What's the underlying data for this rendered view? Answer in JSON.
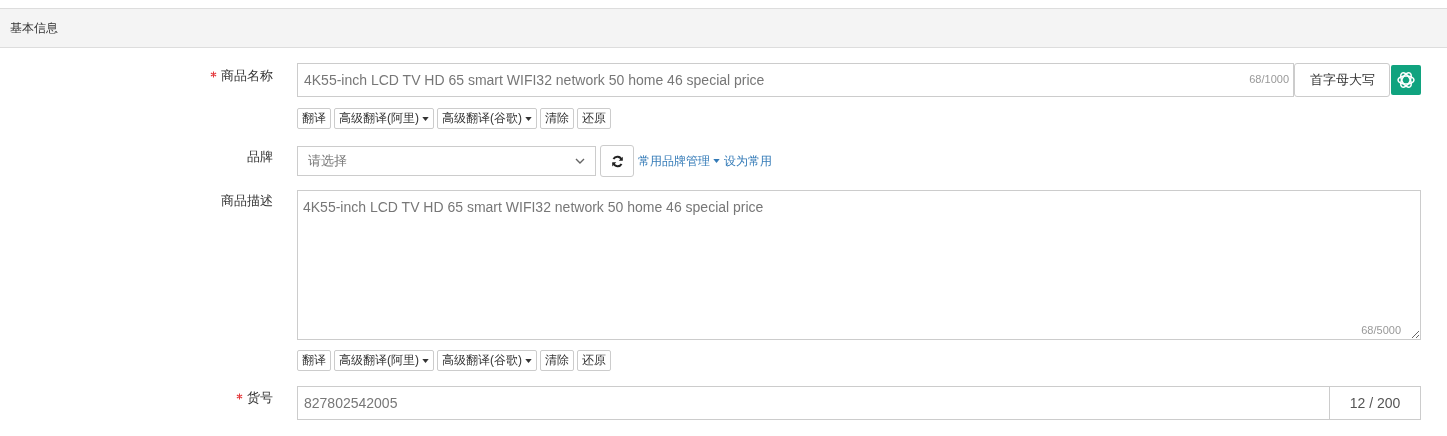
{
  "section_title": "基本信息",
  "product_name": {
    "label": "商品名称",
    "required": true,
    "value": "4K55-inch LCD TV HD 65 smart WIFI32 network 50 home 46 special price",
    "counter": "68/1000",
    "capitalize_button": "首字母大写",
    "tools": [
      {
        "label": "翻译",
        "kind": "plain"
      },
      {
        "label": "高级翻译(阿里)",
        "kind": "dropdown"
      },
      {
        "label": "高级翻译(谷歌)",
        "kind": "dropdown"
      },
      {
        "label": "清除",
        "kind": "plain"
      },
      {
        "label": "还原",
        "kind": "plain"
      }
    ]
  },
  "brand": {
    "label": "品牌",
    "required": false,
    "placeholder": "请选择",
    "manage_link": "常用品牌管理",
    "set_link": "设为常用"
  },
  "description": {
    "label": "商品描述",
    "required": false,
    "value": "4K55-inch LCD TV HD 65 smart WIFI32 network 50 home 46 special price",
    "counter": "68/5000",
    "tools": [
      {
        "label": "翻译",
        "kind": "plain"
      },
      {
        "label": "高级翻译(阿里)",
        "kind": "dropdown"
      },
      {
        "label": "高级翻译(谷歌)",
        "kind": "dropdown"
      },
      {
        "label": "清除",
        "kind": "plain"
      },
      {
        "label": "还原",
        "kind": "plain"
      }
    ]
  },
  "sku": {
    "label": "货号",
    "required": true,
    "value": "827802542005",
    "counter": "12 / 200"
  }
}
